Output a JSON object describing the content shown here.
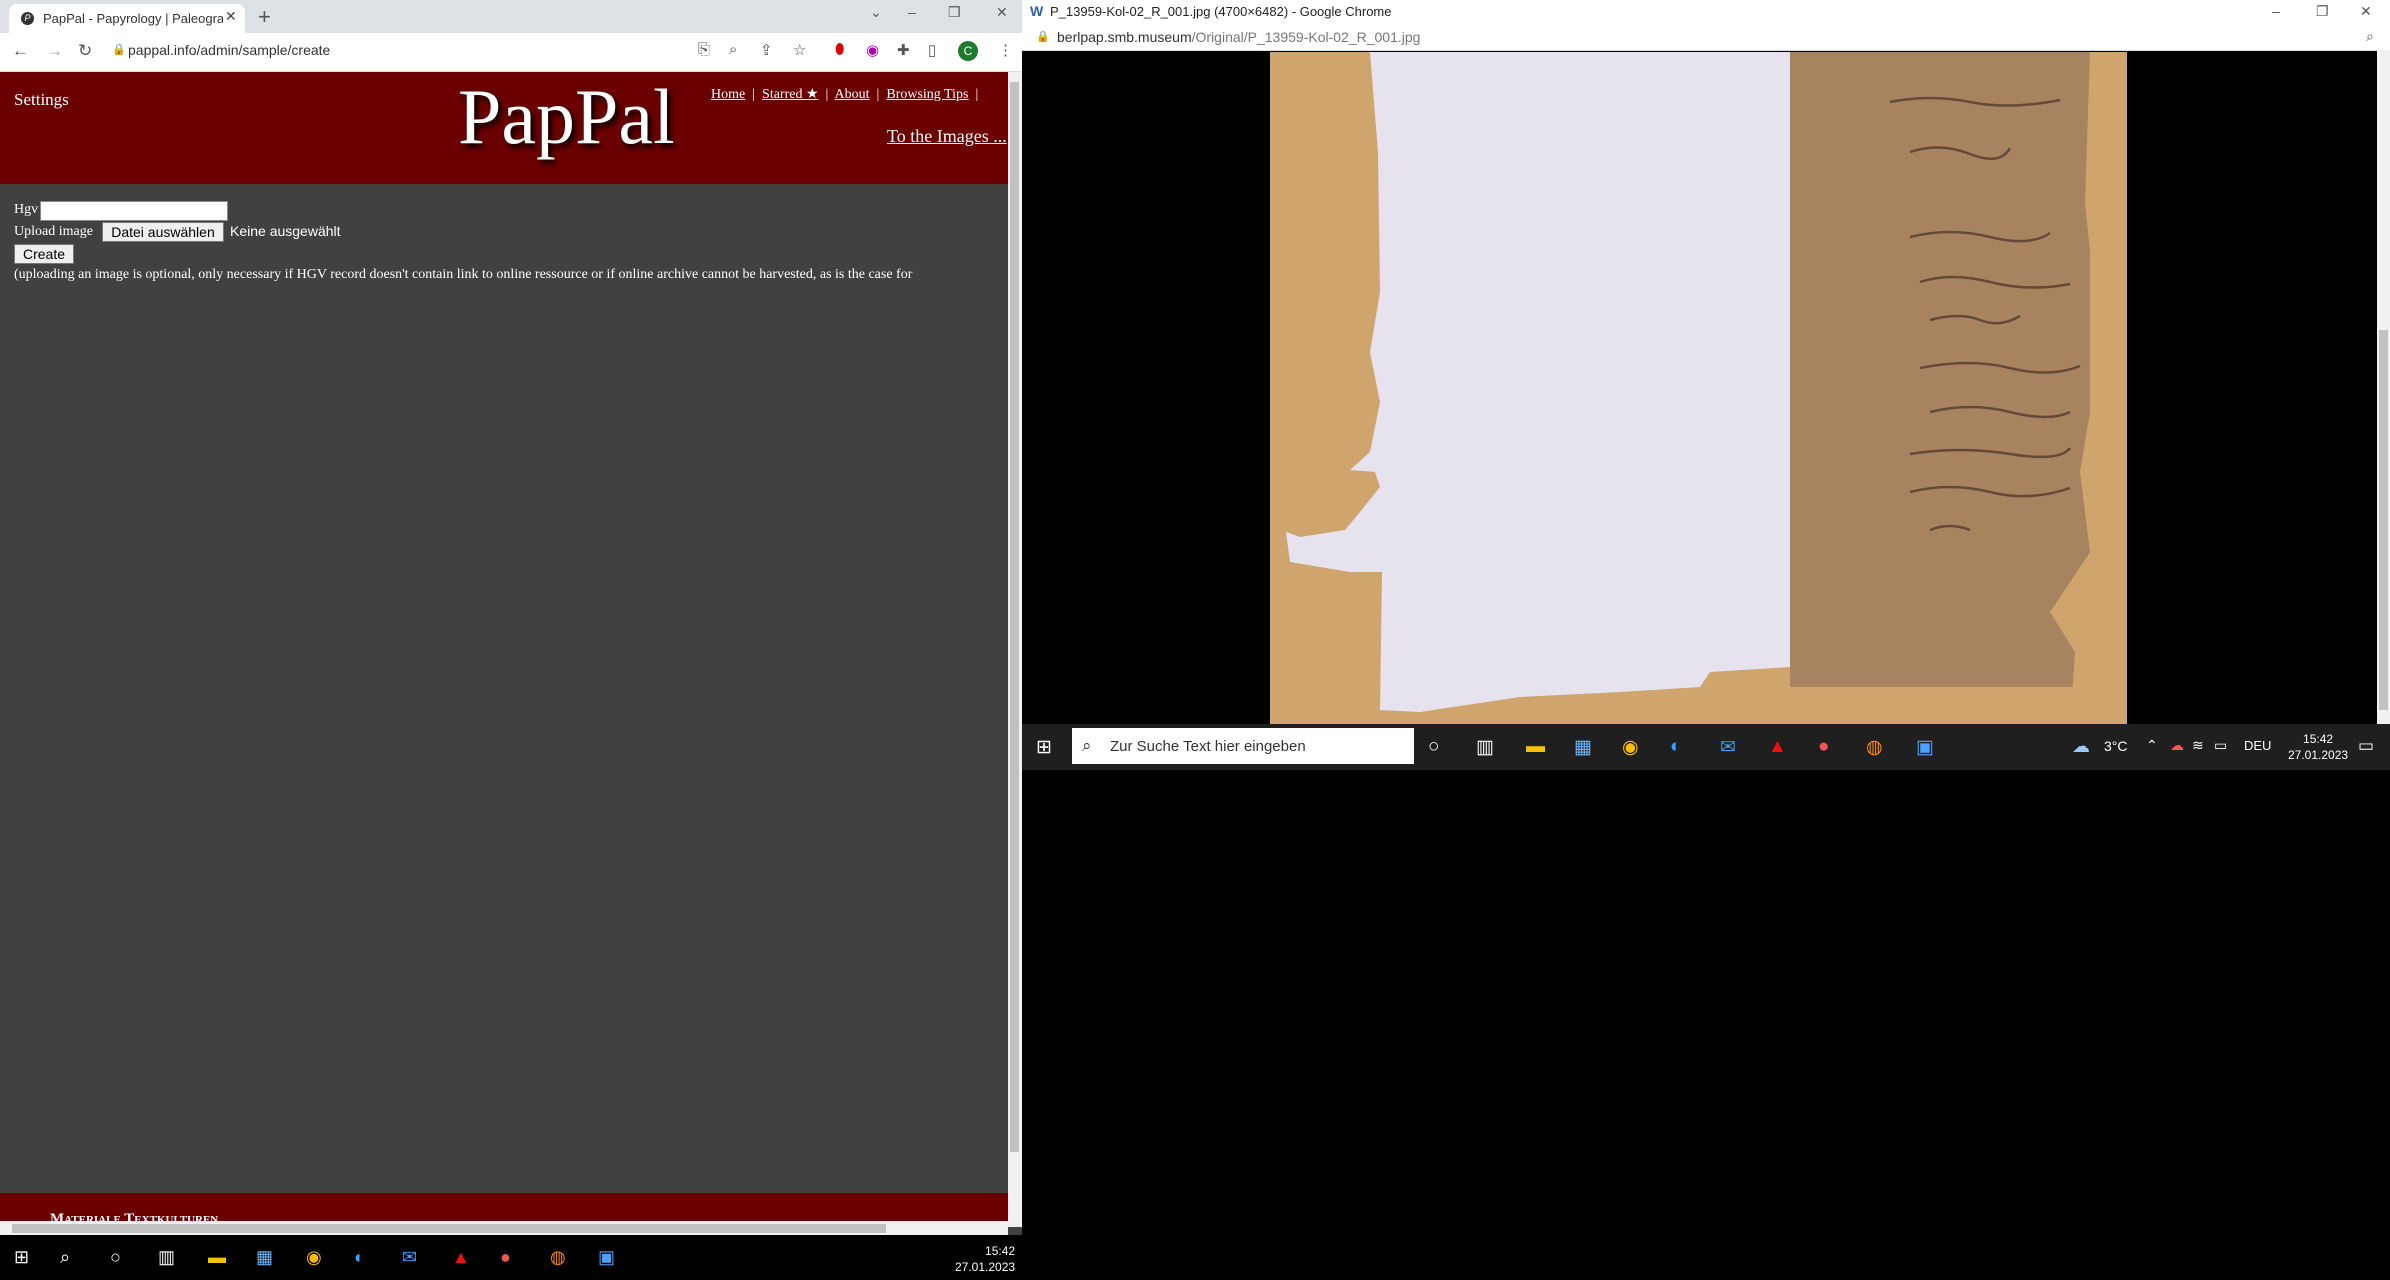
{
  "left_window": {
    "tab_title": "PapPal - Papyrology | Paleograph",
    "url": "pappal.info/admin/sample/create",
    "avatar_letter": "C",
    "header": {
      "settings": "Settings",
      "logo": "PapPal",
      "nav": [
        "Home",
        "Starred ★",
        "About",
        "Browsing Tips"
      ],
      "to_images": "To the Images ..."
    },
    "form": {
      "hgv_label": "Hgv",
      "upload_label": "Upload image",
      "file_button": "Datei auswählen",
      "file_status": "Keine ausgewählt",
      "create_button": "Create",
      "note": "(uploading an image is optional, only necessary if HGV record doesn't contain link to online ressource or if online archive cannot be harvested, as is the case for"
    },
    "footer": "Materiale Textkulturen",
    "taskbar": {
      "time": "15:42",
      "date": "27.01.2023"
    }
  },
  "right_window": {
    "title": "P_13959-Kol-02_R_001.jpg (4700×6482) - Google Chrome",
    "url_host": "berlpap.smb.museum",
    "url_path": "/Original/P_13959-Kol-02_R_001.jpg",
    "taskbar": {
      "search_placeholder": "Zur Suche Text hier eingeben",
      "weather": "3°C",
      "lang": "DEU",
      "time": "15:42",
      "date": "27.01.2023"
    }
  },
  "colors": {
    "header": "#6b0000",
    "page_bg": "#414141",
    "papyrus": "#c8a06a",
    "paper": "#e6e3ee"
  },
  "icons": [
    "back-arrow-icon",
    "forward-arrow-icon",
    "reload-icon",
    "lock-icon",
    "translate-icon",
    "zoom-icon",
    "share-icon",
    "star-icon",
    "extensions-icon",
    "windows-start-icon",
    "search-icon",
    "chrome-icon",
    "edge-icon",
    "mail-icon",
    "acrobat-icon",
    "powerpoint-icon",
    "firefox-icon",
    "cloud-icon",
    "notification-icon"
  ]
}
